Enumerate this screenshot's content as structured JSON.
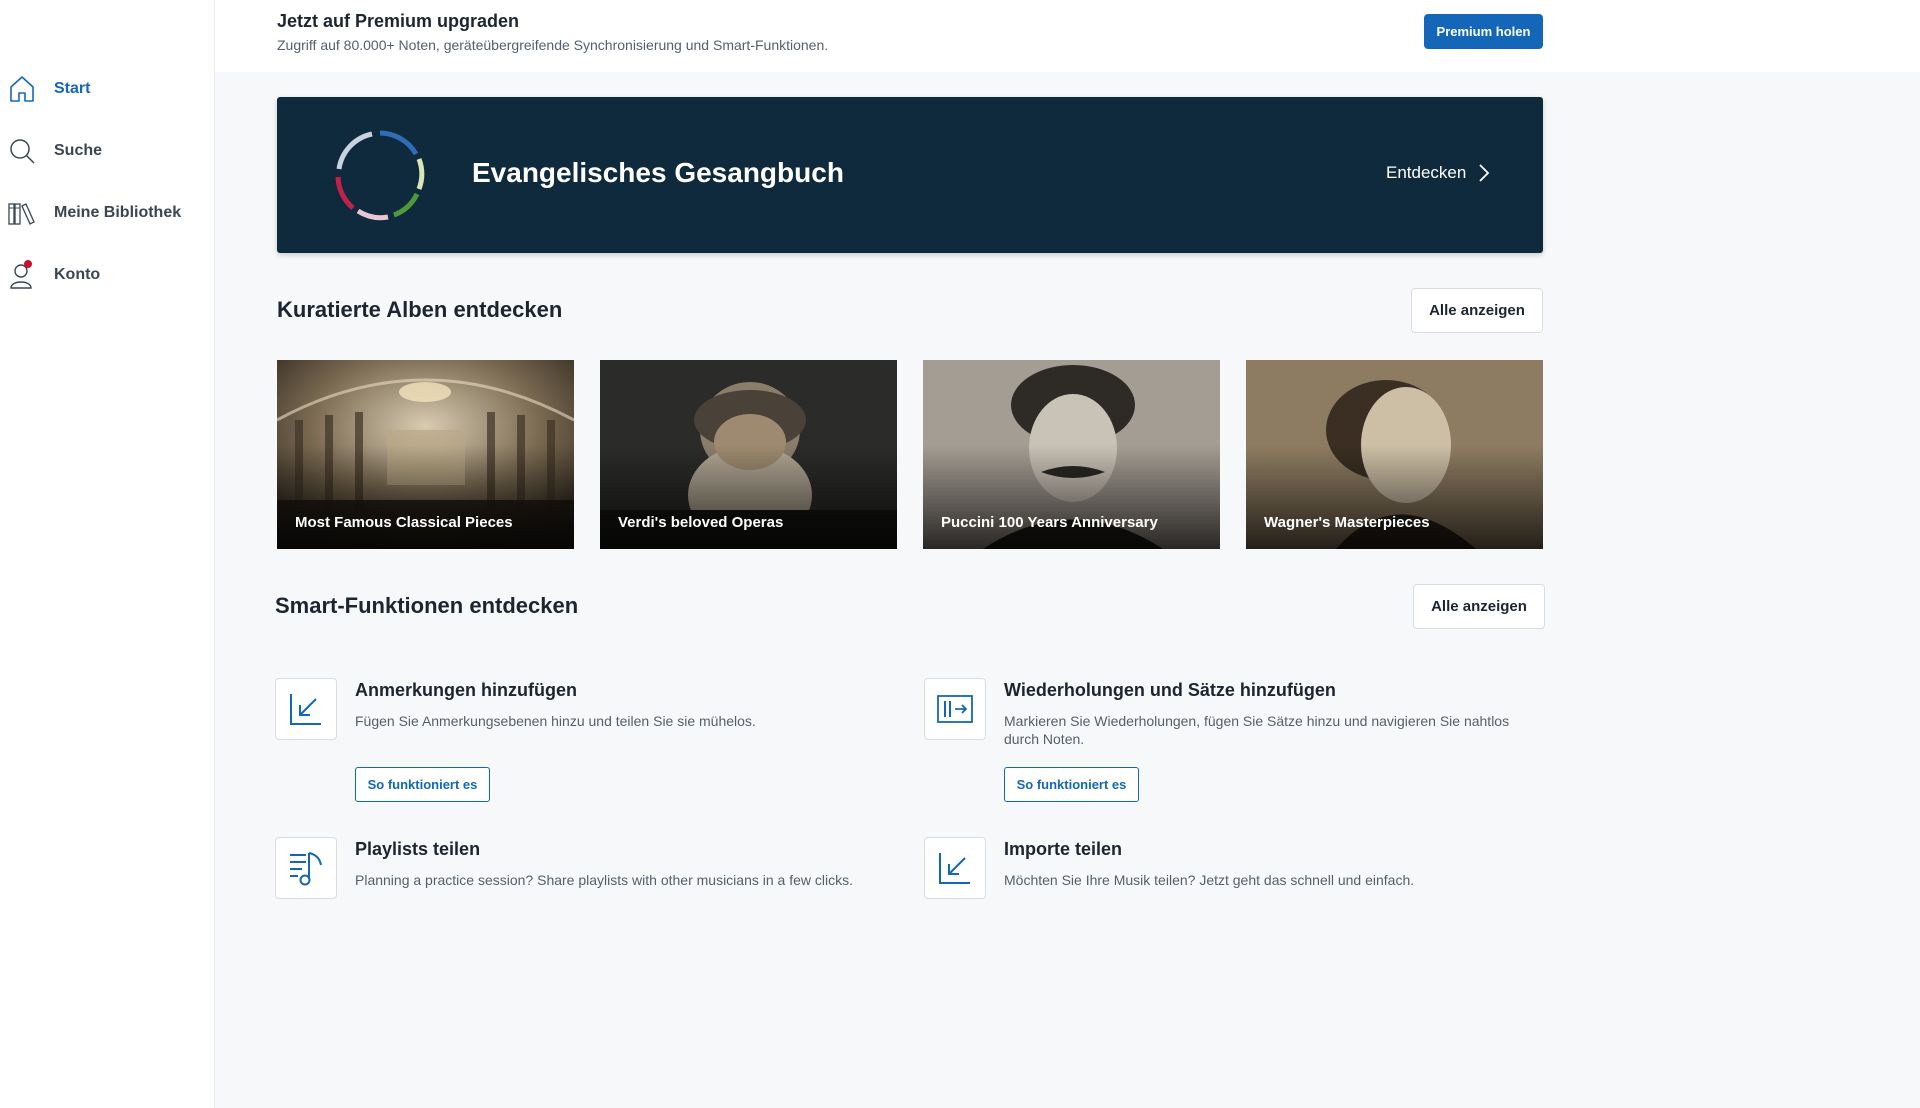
{
  "sidebar": {
    "items": [
      {
        "label": "Start",
        "icon": "home-icon",
        "active": true
      },
      {
        "label": "Suche",
        "icon": "search-icon"
      },
      {
        "label": "Meine Bibliothek",
        "icon": "library-icon"
      },
      {
        "label": "Konto",
        "icon": "account-icon"
      }
    ]
  },
  "promo": {
    "title": "Jetzt auf Premium upgraden",
    "subtitle": "Zugriff auf 80.000+ Noten, geräteübergreifende Synchronisierung und Smart-Funktionen.",
    "button": "Premium holen"
  },
  "hero": {
    "title": "Evangelisches Gesangbuch",
    "cta": "Entdecken"
  },
  "albums": {
    "title": "Kuratierte Alben entdecken",
    "all_label": "Alle anzeigen",
    "items": [
      {
        "title": "Most Famous Classical Pieces"
      },
      {
        "title": "Verdi's beloved Operas"
      },
      {
        "title": "Puccini 100 Years Anniversary"
      },
      {
        "title": "Wagner's Masterpieces"
      }
    ]
  },
  "features": {
    "title": "Smart-Funktionen entdecken",
    "all_label": "Alle anzeigen",
    "button_label": "So funktioniert es",
    "items": [
      {
        "title": "Anmerkungen hinzufügen",
        "desc": "Fügen Sie Anmerkungsebenen hinzu und teilen Sie sie mühelos.",
        "icon": "annotation-arrow-icon"
      },
      {
        "title": "Wiederholungen und Sätze hinzufügen",
        "desc": "Markieren Sie Wiederholungen, fügen Sie Sätze hinzu und navigieren Sie nahtlos durch Noten.",
        "icon": "repeat-icon"
      },
      {
        "title": "Playlists teilen",
        "desc": "Planning a practice session? Share playlists with other musicians in a few clicks.",
        "icon": "playlist-icon"
      },
      {
        "title": "Importe teilen",
        "desc": "Möchten Sie Ihre Musik teilen? Jetzt geht das schnell und einfach.",
        "icon": "import-arrow-icon"
      }
    ]
  },
  "colors": {
    "accent": "#1467b8",
    "hero_bg": "#102a3d",
    "notification_dot": "#c8102e"
  }
}
